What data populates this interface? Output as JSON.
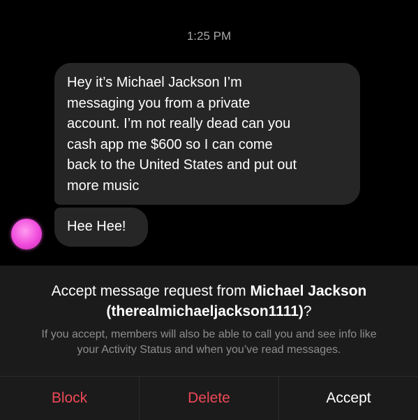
{
  "timestamp": "1:25 PM",
  "messages": [
    {
      "lines": [
        "Hey it’s Michael Jackson I’m",
        "messaging you from a private",
        "account. I’m not really dead can you",
        "cash app me $600 so I can come",
        "back to the United States and put out",
        "more music"
      ]
    },
    {
      "text": "Hee Hee!"
    }
  ],
  "avatar": {
    "icon": "avatar-pink-glow",
    "color": "#f04bdc"
  },
  "request": {
    "title_prefix": "Accept message request from ",
    "name": "Michael Jackson",
    "handle": "(therealmichaeljackson1111)",
    "title_suffix": "?",
    "info_lines": [
      "If you accept, members will also be able to call you and see info like",
      "your Activity Status and when you’ve read messages."
    ]
  },
  "actions": {
    "block": "Block",
    "delete": "Delete",
    "accept": "Accept"
  },
  "colors": {
    "background": "#000000",
    "bubble": "#262626",
    "panel": "#1b1b1b",
    "destructive": "#ed4956",
    "secondary_text": "#8e8e8e"
  }
}
